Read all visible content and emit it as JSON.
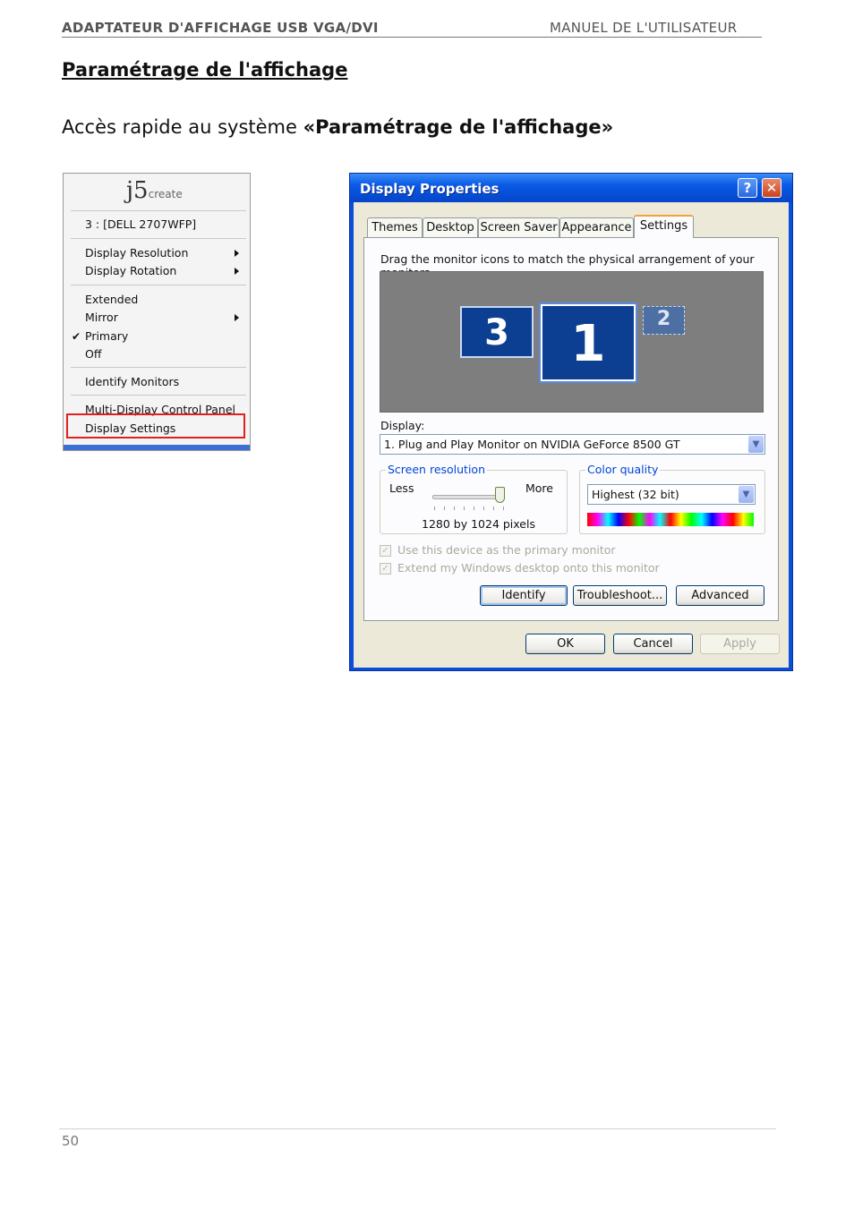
{
  "header": {
    "left": "ADAPTATEUR D'AFFICHAGE USB VGA/DVI",
    "right": "MANUEL DE L'UTILISATEUR"
  },
  "section_title": "Paramétrage de l'affichage",
  "intro": {
    "prefix": "Accès rapide au système ",
    "bold": "«Paramétrage de l'affichage»"
  },
  "j5_menu": {
    "logo_main": "j5",
    "logo_sub": "create",
    "monitor": "3 : [DELL 2707WFP]",
    "items": {
      "display_resolution": "Display Resolution",
      "display_rotation": "Display Rotation",
      "extended": "Extended",
      "mirror": "Mirror",
      "primary": "Primary",
      "off": "Off",
      "identify_monitors": "Identify Monitors",
      "multi_display": "Multi-Display Control Panel",
      "display_settings": "Display Settings"
    },
    "checked_item": "Primary",
    "check_glyph": "✔"
  },
  "dialog": {
    "title": "Display Properties",
    "help_glyph": "?",
    "close_glyph": "✕",
    "tabs": [
      "Themes",
      "Desktop",
      "Screen Saver",
      "Appearance",
      "Settings"
    ],
    "active_tab": "Settings",
    "instruction": "Drag the monitor icons to match the physical arrangement of your monitors.",
    "monitors": [
      "3",
      "1",
      "2"
    ],
    "display_label": "Display:",
    "display_value": "1. Plug and Play Monitor on NVIDIA GeForce 8500 GT",
    "screen_resolution": {
      "title": "Screen resolution",
      "less": "Less",
      "more": "More",
      "value": "1280 by 1024 pixels"
    },
    "color_quality": {
      "title": "Color quality",
      "value": "Highest (32 bit)"
    },
    "checkbox_primary": "Use this device as the primary monitor",
    "checkbox_extend": "Extend my Windows desktop onto this monitor",
    "check_glyph": "✓",
    "buttons": {
      "identify": "Identify",
      "troubleshoot": "Troubleshoot...",
      "advanced": "Advanced",
      "ok": "OK",
      "cancel": "Cancel",
      "apply": "Apply"
    },
    "dropdown_glyph": "▼"
  },
  "footer": {
    "page_number": "50"
  }
}
